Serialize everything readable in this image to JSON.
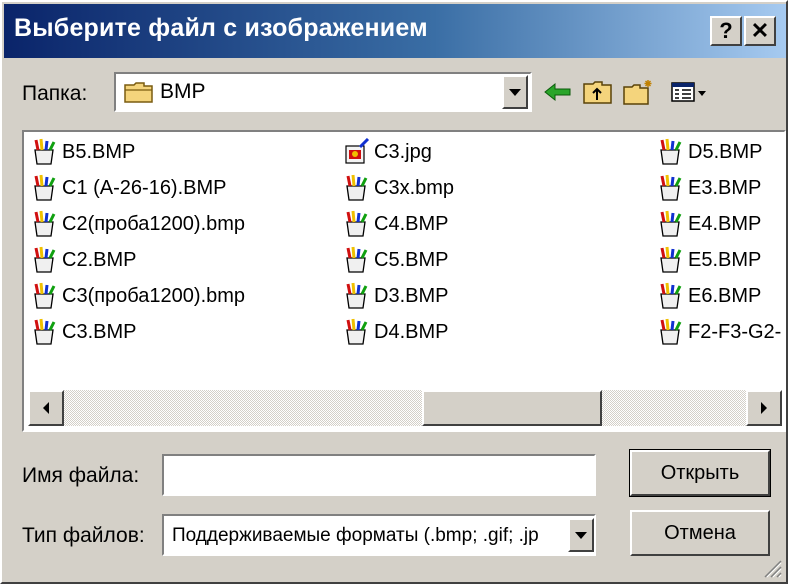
{
  "window": {
    "title": "Выберите файл с изображением",
    "help_button": "?",
    "close_button": "✕"
  },
  "folder": {
    "label": "Папка:",
    "value": "BMP",
    "icon": "folder-icon"
  },
  "toolbar": {
    "back_icon": "back-arrow-icon",
    "up_icon": "up-folder-icon",
    "new_folder_icon": "new-folder-icon",
    "view_icon": "view-menu-icon"
  },
  "files": {
    "columns": [
      [
        {
          "name": "B5.BMP",
          "icon": "bmp-file-icon"
        },
        {
          "name": "C1 (A-26-16).BMP",
          "icon": "bmp-file-icon"
        },
        {
          "name": "C2(проба1200).bmp",
          "icon": "bmp-file-icon"
        },
        {
          "name": "C2.BMP",
          "icon": "bmp-file-icon"
        },
        {
          "name": "C3(проба1200).bmp",
          "icon": "bmp-file-icon"
        },
        {
          "name": "C3.BMP",
          "icon": "bmp-file-icon"
        }
      ],
      [
        {
          "name": "C3.jpg",
          "icon": "jpg-file-icon"
        },
        {
          "name": "C3x.bmp",
          "icon": "bmp-file-icon"
        },
        {
          "name": "C4.BMP",
          "icon": "bmp-file-icon"
        },
        {
          "name": "C5.BMP",
          "icon": "bmp-file-icon"
        },
        {
          "name": "D3.BMP",
          "icon": "bmp-file-icon"
        },
        {
          "name": "D4.BMP",
          "icon": "bmp-file-icon"
        }
      ],
      [
        {
          "name": "D5.BMP",
          "icon": "bmp-file-icon"
        },
        {
          "name": "E3.BMP",
          "icon": "bmp-file-icon"
        },
        {
          "name": "E4.BMP",
          "icon": "bmp-file-icon"
        },
        {
          "name": "E5.BMP",
          "icon": "bmp-file-icon"
        },
        {
          "name": "E6.BMP",
          "icon": "bmp-file-icon"
        },
        {
          "name": "F2-F3-G2-",
          "icon": "bmp-file-icon"
        }
      ]
    ]
  },
  "filename": {
    "label": "Имя файла:",
    "value": ""
  },
  "filetype": {
    "label": "Тип файлов:",
    "value": "Поддерживаемые форматы (.bmp; .gif; .jp"
  },
  "buttons": {
    "open": "Открыть",
    "cancel": "Отмена"
  },
  "colors": {
    "titlebar_start": "#0a246a",
    "titlebar_end": "#a6caf0",
    "face": "#d4d0c8"
  }
}
